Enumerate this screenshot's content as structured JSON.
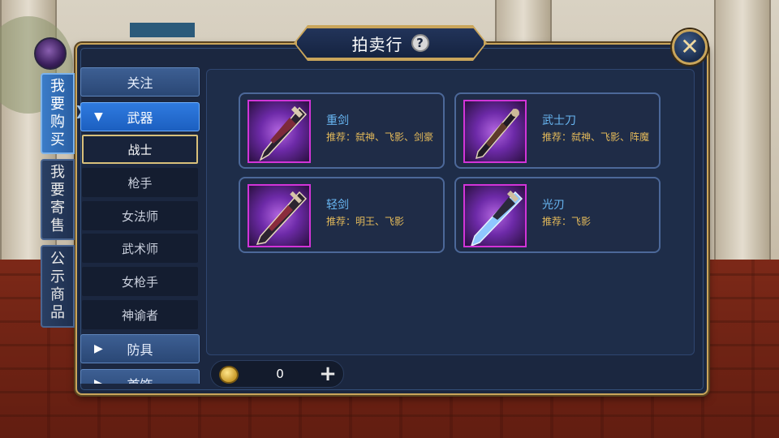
{
  "window": {
    "title": "拍卖行"
  },
  "side_tabs": [
    {
      "label": "我要购买",
      "lines": [
        "我",
        "要",
        "购",
        "买"
      ],
      "active": true
    },
    {
      "label": "我要寄售",
      "lines": [
        "我",
        "要",
        "寄",
        "售"
      ],
      "active": false
    },
    {
      "label": "公示商品",
      "lines": [
        "公",
        "示",
        "商",
        "品"
      ],
      "active": false
    }
  ],
  "categories": {
    "follow": "关注",
    "weapons": "武器",
    "armor": "防具",
    "accessory_partial": "首饰",
    "sub_items": [
      "战士",
      "枪手",
      "女法师",
      "武术师",
      "女枪手",
      "神谕者"
    ],
    "selected_sub": "战士"
  },
  "items": [
    {
      "name": "重剑",
      "recommend": "推荐：弑神、飞影、剑豪"
    },
    {
      "name": "武士刀",
      "recommend": "推荐：弑神、飞影、阵魔"
    },
    {
      "name": "轻剑",
      "recommend": "推荐：明王、飞影"
    },
    {
      "name": "光刃",
      "recommend": "推荐：飞影"
    }
  ],
  "currency": {
    "amount": "0",
    "plus": "+"
  },
  "icons": {
    "help": "question-icon",
    "close": "close-x-icon",
    "coin": "coin-icon",
    "tri_open": "triangle-down-icon",
    "tri_closed": "triangle-right-icon"
  },
  "colors": {
    "panel_bg": "#1b2740",
    "gold_border": "#c9a55b",
    "item_name": "#68b6f2",
    "recommend_text": "#e1b85a",
    "active_tab": "#2f7be0",
    "thumb_border": "#d234d8"
  }
}
